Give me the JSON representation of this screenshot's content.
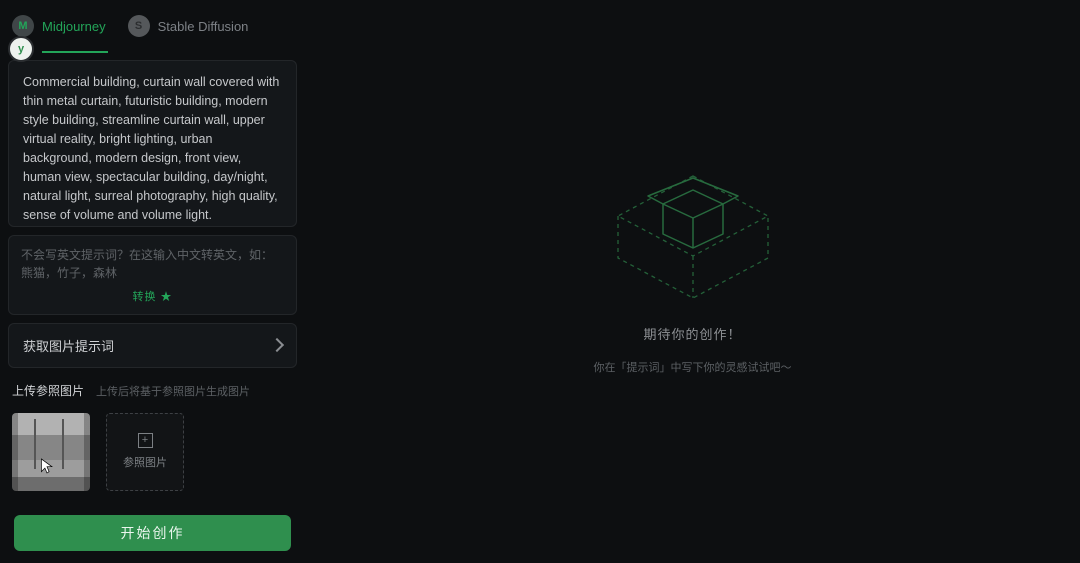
{
  "tabs": {
    "mj": {
      "label": "Midjourney",
      "icon_letter": "M"
    },
    "sd": {
      "label": "Stable Diffusion",
      "icon_letter": "S"
    }
  },
  "avatar_letter": "y",
  "prompt_text": "Commercial building, curtain wall covered with thin metal curtain, futuristic building, modern style building, streamline curtain wall, upper virtual reality, bright lighting, urban background, modern design, front view, human view, spectacular building, day/night, natural light, surreal photography, high quality, sense of volume and volume light.",
  "translate": {
    "placeholder": "不会写英文提示词？在这输入中文转英文，如：熊猫，竹子，森林",
    "action_label": "转换 ★"
  },
  "get_image_prompt_label": "获取图片提示词",
  "upload": {
    "title": "上传参照图片",
    "hint": "上传后将基于参照图片生成图片",
    "slot_label": "参照图片"
  },
  "start_button_label": "开始创作",
  "empty": {
    "title": "期待你的创作！",
    "subtitle": "你在「提示词」中写下你的灵感试试吧～"
  }
}
